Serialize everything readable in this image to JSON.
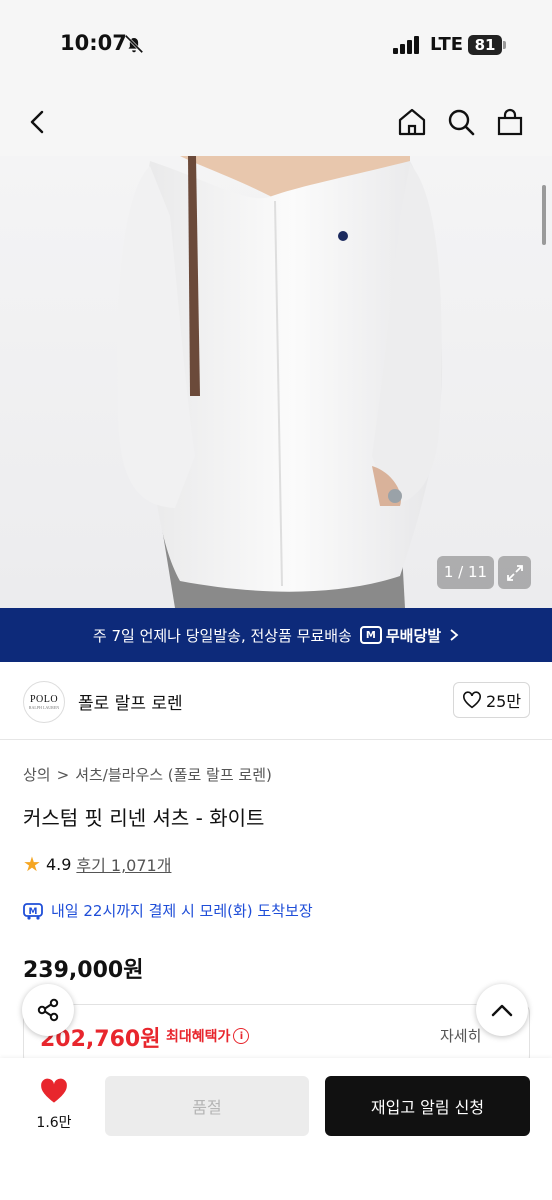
{
  "status": {
    "time": "10:07",
    "network": "LTE",
    "battery": "81"
  },
  "gallery": {
    "counter": "1 / 11"
  },
  "shipping_banner": {
    "text": "주 7일 언제나 당일발송, 전상품 무료배송",
    "badge": "무배당발",
    "badge_icon_text": "M"
  },
  "brand": {
    "logo_text": "POLO",
    "logo_sub": "RALPH LAUREN",
    "name": "폴로 랄프 로렌",
    "likes": "25만"
  },
  "breadcrumb": {
    "category": "상의",
    "subcategory": "셔츠/블라우스 (폴로 랄프 로렌)",
    "separator": ">"
  },
  "product": {
    "title": "커스텀 핏 리넨 셔츠 - 화이트",
    "rating": "4.9",
    "reviews": "후기 1,071개",
    "delivery": "내일 22시까지 결제 시 모레(화) 도착보장",
    "price": "239,000원"
  },
  "benefit": {
    "price": "202,760원",
    "label": "최대혜택가",
    "detail": "자세히"
  },
  "bottom": {
    "wish_count": "1.6만",
    "soldout_label": "품절",
    "restock_label": "재입고 알림 신청"
  },
  "colors": {
    "banner": "#0d2a7a",
    "accent_red": "#e8262d",
    "delivery_blue": "#1f4ed8",
    "star": "#f5a623"
  }
}
